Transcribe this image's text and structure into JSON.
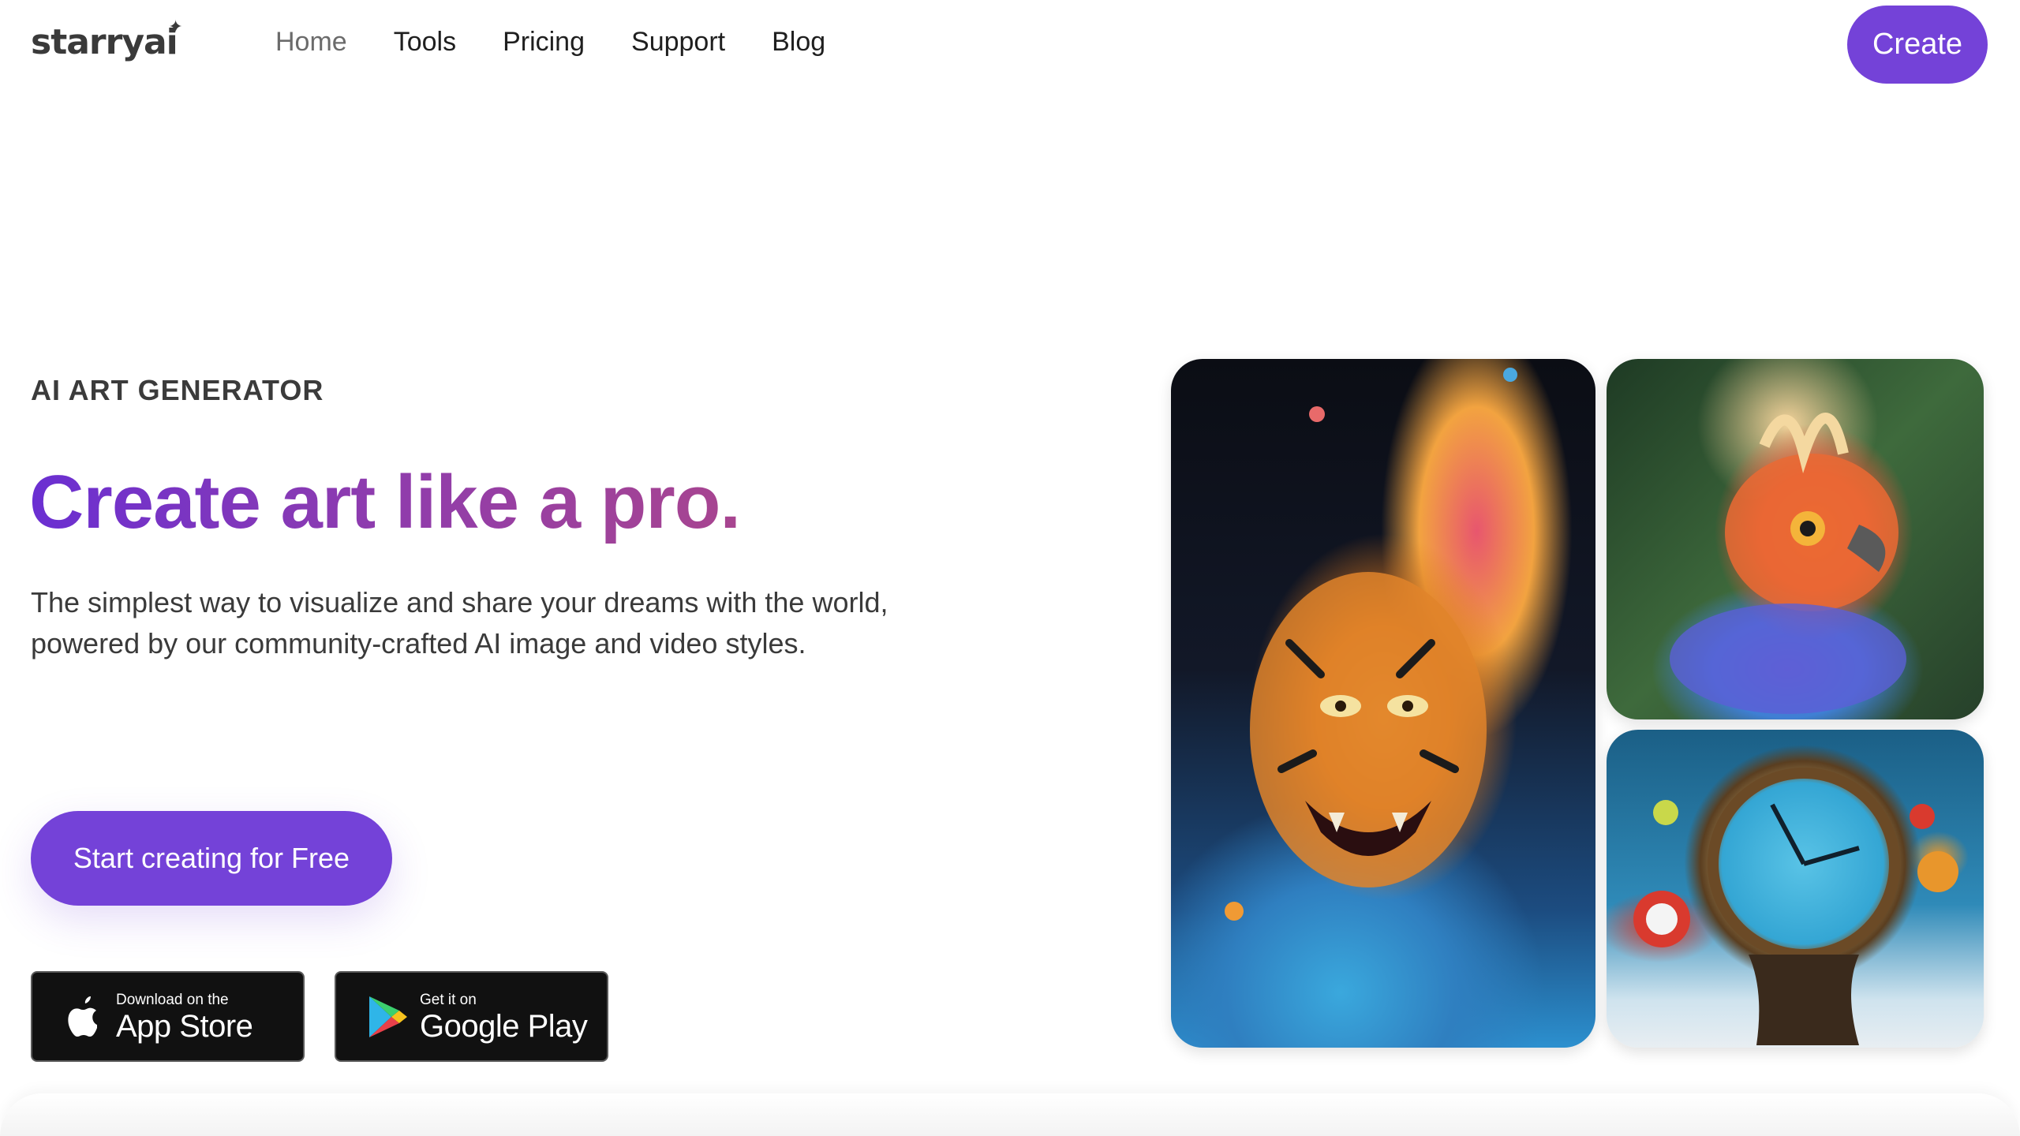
{
  "brand": {
    "logo_text": "starryai",
    "spark": "✦"
  },
  "nav": {
    "items": [
      {
        "label": "Home"
      },
      {
        "label": "Tools"
      },
      {
        "label": "Pricing"
      },
      {
        "label": "Support"
      },
      {
        "label": "Blog"
      }
    ],
    "active": "Home",
    "create_label": "Create"
  },
  "hero": {
    "eyebrow": "AI ART GENERATOR",
    "headline": "Create art like a pro.",
    "subtext": "The simplest way to visualize and share your dreams with the world, powered by our community-crafted AI image and video styles.",
    "cta_label": "Start creating for Free"
  },
  "stores": {
    "apple": {
      "small": "Download on the",
      "big": "App Store",
      "icon": "apple-icon"
    },
    "google": {
      "small": "Get it on",
      "big": "Google Play",
      "icon": "google-play-icon"
    }
  },
  "gallery": [
    {
      "name": "tiger-artwork"
    },
    {
      "name": "bird-artwork"
    },
    {
      "name": "clock-artwork"
    }
  ],
  "colors": {
    "accent": "#7442d8",
    "headline_start": "#6a2fd2",
    "headline_end": "#a8458f",
    "store_bg": "#111111"
  }
}
